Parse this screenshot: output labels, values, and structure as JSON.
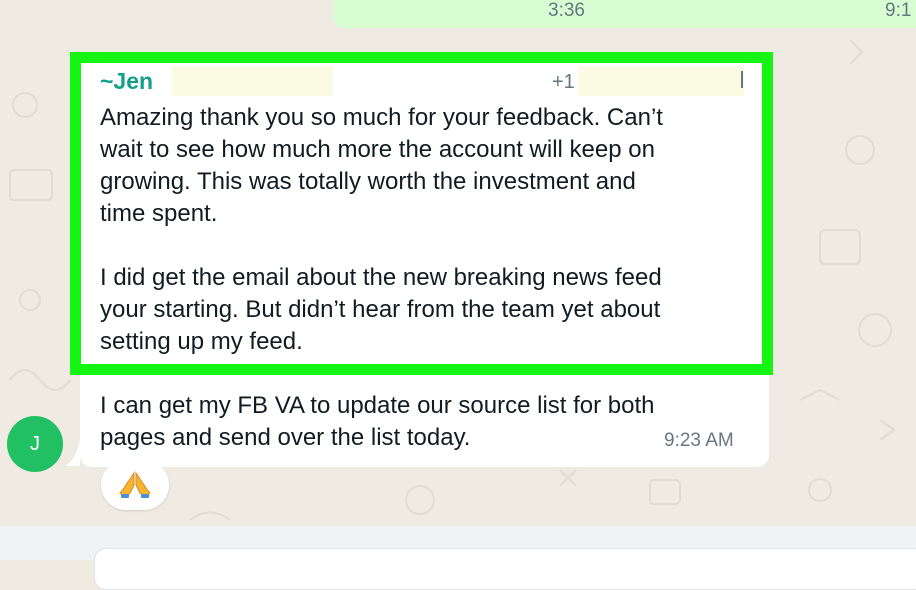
{
  "outgoing": {
    "time_1": "3:36",
    "time_2": "9:1"
  },
  "message": {
    "avatar_initial": "J",
    "sender": "~Jen",
    "phone_prefix": "+1",
    "paragraph_1": "Amazing thank you so much for your feedback. Can’t\nwait to see how much more the account will keep on\ngrowing. This was totally worth the investment and\ntime spent.",
    "paragraph_2": "I did get the email about the new breaking news feed\nyour starting. But didn’t hear from the team yet about\nsetting up my feed.",
    "paragraph_3": "I can get my FB VA to update our source list for both\npages and send over the list today.",
    "time": "9:23 AM",
    "reaction": "folded-hands"
  },
  "colors": {
    "chat_background": "#efeae2",
    "outgoing_bubble": "#d9fdd3",
    "highlight_border": "#14f514",
    "sender_name": "#13a08a",
    "avatar": "#21c063"
  }
}
